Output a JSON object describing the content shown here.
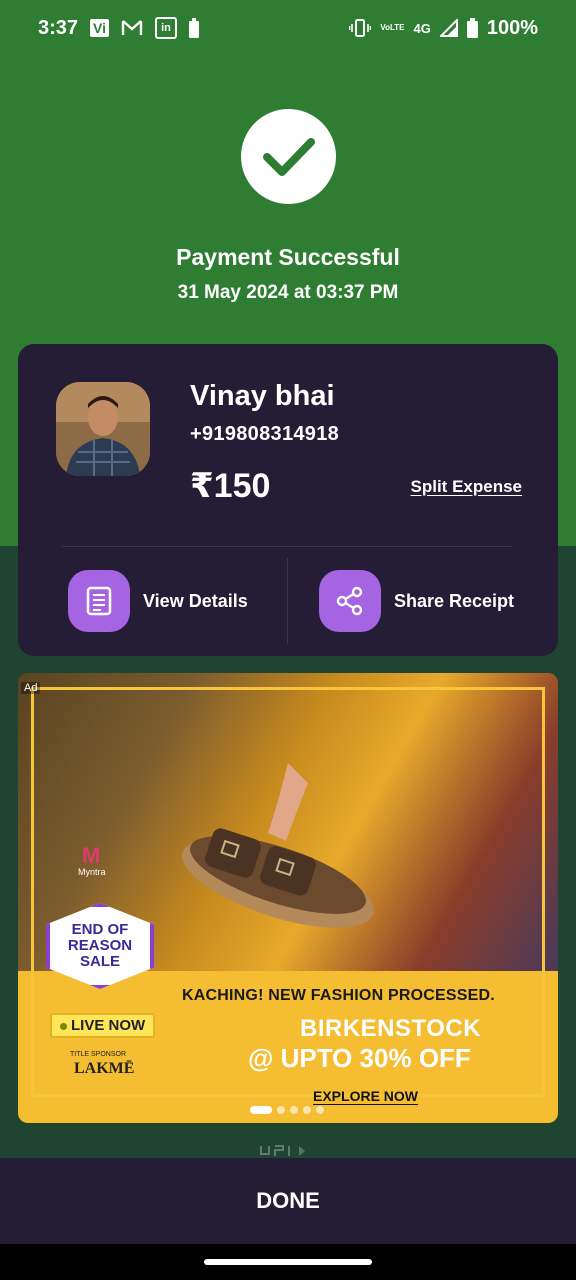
{
  "status_bar": {
    "time": "3:37",
    "carrier_badge": "Vi",
    "network": "4G",
    "volte_line1": "Vo",
    "volte_line2": "LTE",
    "battery": "100%",
    "icons": [
      "gmail-icon",
      "linkedin-icon",
      "battery-saver-icon",
      "vibrate-icon",
      "signal-icon",
      "battery-icon"
    ]
  },
  "payment": {
    "status_title": "Payment Successful",
    "datetime": "31 May 2024 at 03:37 PM"
  },
  "payee": {
    "name": "Vinay bhai",
    "phone": "+919808314918",
    "amount": "₹150",
    "split_label": "Split Expense"
  },
  "actions": {
    "view_details": "View Details",
    "share_receipt": "Share Receipt"
  },
  "ad": {
    "tag": "Ad",
    "sale_badge": "END OF REASON SALE",
    "myntra": "M",
    "myntra_name": "Myntra",
    "live": "LIVE NOW",
    "sponsor_label": "TITLE SPONSOR",
    "sponsor": "LAKMĒ",
    "headline": "KACHING! NEW FASHION PROCESSED.",
    "brand": "BIRKENSTOCK",
    "offer": "@ UPTO 30% OFF",
    "cta": "EXPLORE NOW",
    "carousel_total": 5,
    "carousel_active": 1
  },
  "footer": {
    "done_label": "DONE"
  },
  "colors": {
    "success_green": "#2e7d32",
    "card_bg": "#251c35",
    "accent_purple": "#a565e3",
    "lower_bg": "#1f4532"
  }
}
